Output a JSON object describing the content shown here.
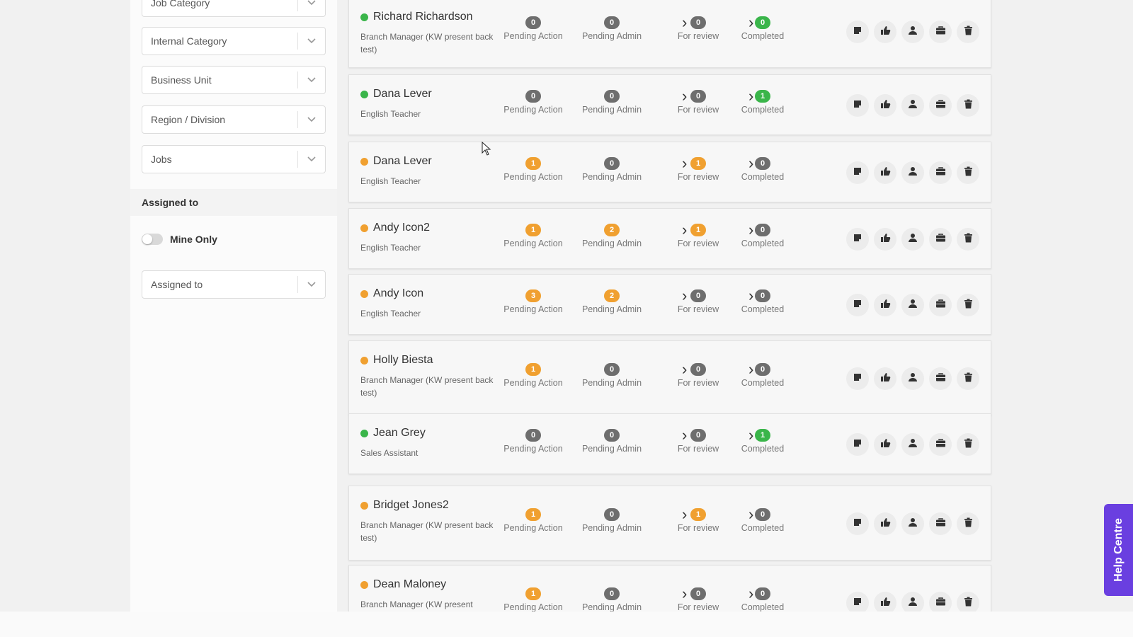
{
  "sidebar": {
    "filters": [
      "Job Category",
      "Internal Category",
      "Business Unit",
      "Region / Division",
      "Jobs"
    ],
    "assigned_section": "Assigned to",
    "mine_only_label": "Mine Only",
    "assigned_select": "Assigned to"
  },
  "stat_labels": [
    "Pending Action",
    "Pending Admin",
    "For review",
    "Completed"
  ],
  "help_label": "Help Centre",
  "colors": {
    "green": "#3ab54a",
    "orange": "#f0a030",
    "grey": "#6e6e6e",
    "help": "#6a3fe0"
  },
  "rows": [
    {
      "name": "Richard Richardson",
      "role": "Branch Manager (KW present back test)",
      "status": "green",
      "counts": [
        {
          "v": "0",
          "c": "grey"
        },
        {
          "v": "0",
          "c": "grey"
        },
        {
          "v": "0",
          "c": "grey"
        },
        {
          "v": "0",
          "c": "green"
        }
      ]
    },
    {
      "name": "Dana Lever",
      "role": "English Teacher",
      "status": "green",
      "counts": [
        {
          "v": "0",
          "c": "grey"
        },
        {
          "v": "0",
          "c": "grey"
        },
        {
          "v": "0",
          "c": "grey"
        },
        {
          "v": "1",
          "c": "green"
        }
      ]
    },
    {
      "name": "Dana Lever",
      "role": "English Teacher",
      "status": "orange",
      "counts": [
        {
          "v": "1",
          "c": "orange"
        },
        {
          "v": "0",
          "c": "grey"
        },
        {
          "v": "1",
          "c": "orange"
        },
        {
          "v": "0",
          "c": "grey"
        }
      ]
    },
    {
      "name": "Andy Icon2",
      "role": "English Teacher",
      "status": "orange",
      "counts": [
        {
          "v": "1",
          "c": "orange"
        },
        {
          "v": "2",
          "c": "orange"
        },
        {
          "v": "1",
          "c": "orange"
        },
        {
          "v": "0",
          "c": "grey"
        }
      ]
    },
    {
      "name": "Andy Icon",
      "role": "English Teacher",
      "status": "orange",
      "counts": [
        {
          "v": "3",
          "c": "orange"
        },
        {
          "v": "2",
          "c": "orange"
        },
        {
          "v": "0",
          "c": "grey"
        },
        {
          "v": "0",
          "c": "grey"
        }
      ]
    },
    {
      "name": "Holly Biesta",
      "role": "Branch Manager (KW present back test)",
      "status": "orange",
      "counts": [
        {
          "v": "1",
          "c": "orange"
        },
        {
          "v": "0",
          "c": "grey"
        },
        {
          "v": "0",
          "c": "grey"
        },
        {
          "v": "0",
          "c": "grey"
        }
      ]
    },
    {
      "name": "Jean Grey",
      "role": "Sales Assistant",
      "status": "green",
      "counts": [
        {
          "v": "0",
          "c": "grey"
        },
        {
          "v": "0",
          "c": "grey"
        },
        {
          "v": "0",
          "c": "grey"
        },
        {
          "v": "1",
          "c": "green"
        }
      ]
    },
    {
      "name": "Bridget Jones2",
      "role": "Branch Manager (KW present back test)",
      "status": "orange",
      "counts": [
        {
          "v": "1",
          "c": "orange"
        },
        {
          "v": "0",
          "c": "grey"
        },
        {
          "v": "1",
          "c": "orange"
        },
        {
          "v": "0",
          "c": "grey"
        }
      ]
    },
    {
      "name": "Dean Maloney",
      "role": "Branch Manager (KW present",
      "status": "orange",
      "counts": [
        {
          "v": "1",
          "c": "orange"
        },
        {
          "v": "0",
          "c": "grey"
        },
        {
          "v": "0",
          "c": "grey"
        },
        {
          "v": "0",
          "c": "grey"
        }
      ]
    }
  ],
  "action_icons": [
    "note-icon",
    "thumbs-up-icon",
    "user-icon",
    "briefcase-icon",
    "trash-icon"
  ]
}
